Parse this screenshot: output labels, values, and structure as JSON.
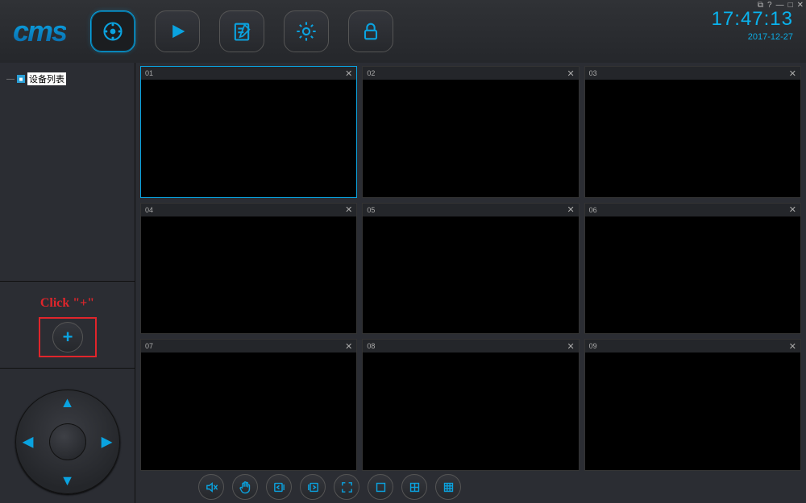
{
  "app": {
    "logo": "cms"
  },
  "clock": {
    "time": "17:47:13",
    "date": "2017-12-27"
  },
  "win_controls": {
    "switch": "⧉",
    "help": "?",
    "min": "—",
    "max": "□",
    "close": "✕"
  },
  "top_icons": {
    "record": "record-icon",
    "play": "play-icon",
    "log": "log-icon",
    "settings": "settings-icon",
    "lock": "lock-icon"
  },
  "sidebar": {
    "tree_root": "设备列表",
    "click_hint": "Click \"+\"",
    "add_label": "+"
  },
  "ptz": {
    "up": "▲",
    "down": "▼",
    "left": "◀",
    "right": "▶"
  },
  "cells": [
    {
      "label": "01",
      "close": "✕",
      "active": true
    },
    {
      "label": "02",
      "close": "✕",
      "active": false
    },
    {
      "label": "03",
      "close": "✕",
      "active": false
    },
    {
      "label": "04",
      "close": "✕",
      "active": false
    },
    {
      "label": "05",
      "close": "✕",
      "active": false
    },
    {
      "label": "06",
      "close": "✕",
      "active": false
    },
    {
      "label": "07",
      "close": "✕",
      "active": false
    },
    {
      "label": "08",
      "close": "✕",
      "active": false
    },
    {
      "label": "09",
      "close": "✕",
      "active": false
    }
  ],
  "bottom_icons": {
    "mute": "mute-icon",
    "talk": "talk-icon",
    "snapshot": "snapshot-icon",
    "record_local": "record-local-icon",
    "fullscreen": "fullscreen-icon",
    "layout1": "layout-1-icon",
    "layout4": "layout-4-icon",
    "layout9": "layout-9-icon"
  }
}
